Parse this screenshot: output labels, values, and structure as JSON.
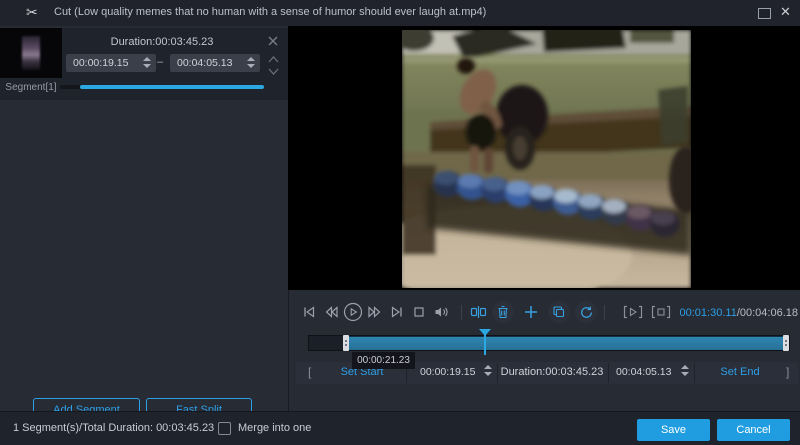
{
  "titlebar": {
    "title": "Cut (Low quality memes that no human with a sense of humor should ever laugh at.mp4)"
  },
  "segment_panel": {
    "duration_label": "Duration:00:03:45.23",
    "start_value": "00:00:19.15",
    "dash": "–",
    "end_value": "00:04:05.13",
    "segment_label": "Segment[1]",
    "add_segment": "Add Segment",
    "fast_split": "Fast Split"
  },
  "player": {
    "current_time": "00:01:30.11",
    "time_separator": "/",
    "total_time": "00:04:06.18",
    "playhead_tooltip": "00:00:21.23"
  },
  "trim_row": {
    "open_bracket": "[",
    "set_start": "Set Start",
    "start_value": "00:00:19.15",
    "duration_label": "Duration:00:03:45.23",
    "end_value": "00:04:05.13",
    "set_end": "Set End",
    "close_bracket": "]"
  },
  "footer": {
    "summary": "1 Segment(s)/Total Duration: 00:03:45.23",
    "merge_label": "Merge into one",
    "save": "Save",
    "cancel": "Cancel"
  },
  "icons": {
    "app": "✂",
    "maximize": "□",
    "close": "✕",
    "remove_segment": "✕",
    "move_up": "chevron-up",
    "move_down": "chevron-down",
    "skip_start": "prev-track",
    "step_back": "rewind",
    "play": "play-circle",
    "step_forward": "fast-forward",
    "skip_end": "next-track",
    "stop": "stop-square",
    "volume": "speaker",
    "split": "split-segment",
    "delete": "trash",
    "add": "+",
    "copy": "duplicate",
    "reset": "undo-arrow",
    "preview_play": "bracket-play",
    "preview_stop": "bracket-stop"
  },
  "colors": {
    "accent_blue": "#2e9fe6",
    "button_blue": "#1f9de0",
    "timeline_fill": "#2b7ea8",
    "progress_blue": "#2ba7e2"
  }
}
